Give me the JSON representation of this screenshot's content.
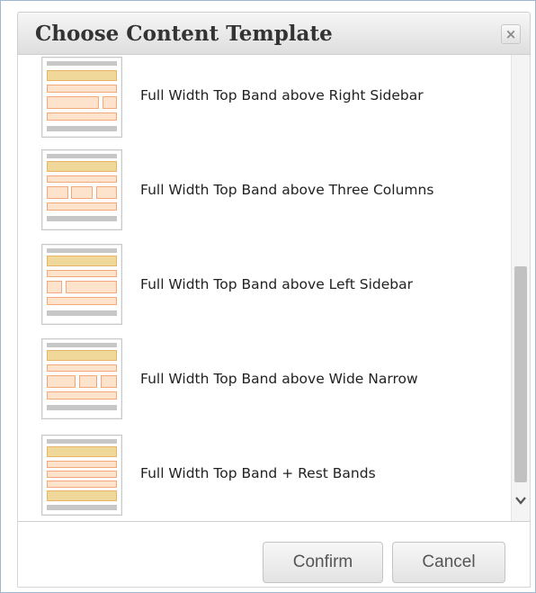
{
  "dialog": {
    "title": "Choose Content Template",
    "close_glyph": "×",
    "templates": [
      {
        "label": "Full Width Top Band above Right Sidebar",
        "icon": "layout-top-band-right-sidebar-icon"
      },
      {
        "label": "Full Width Top Band above Three Columns",
        "icon": "layout-top-band-three-columns-icon"
      },
      {
        "label": "Full Width Top Band above Left Sidebar",
        "icon": "layout-top-band-left-sidebar-icon"
      },
      {
        "label": "Full Width Top Band above Wide Narrow",
        "icon": "layout-top-band-wide-narrow-icon"
      },
      {
        "label": "Full Width Top Band + Rest Bands",
        "icon": "layout-top-band-rest-bands-icon"
      }
    ],
    "buttons": {
      "confirm": "Confirm",
      "cancel": "Cancel"
    }
  },
  "colors": {
    "band_gray": "#c7c7c7",
    "band_tan": "#f0d79a",
    "band_peach": "#fde2cc",
    "band_orange_border": "#f3a87a",
    "dialog_border": "#9fb7cf"
  }
}
